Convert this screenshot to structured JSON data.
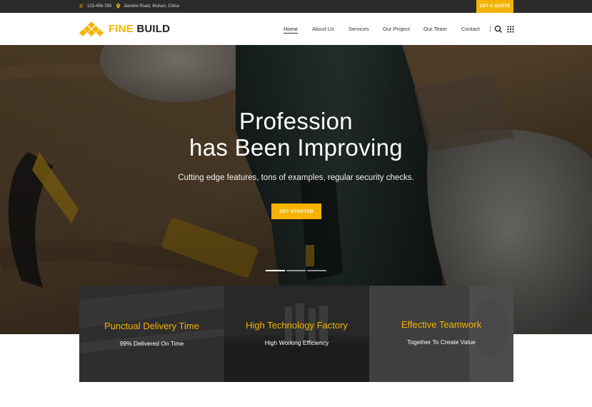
{
  "topbar": {
    "phone": "123-456-789",
    "address": "Jianshe Road, Wuhan, China",
    "quote_label": "GET A QUOTE"
  },
  "logo": {
    "word1": "FINE",
    "word2": "BUILD"
  },
  "nav": {
    "items": [
      {
        "label": "Home",
        "active": true
      },
      {
        "label": "About Us"
      },
      {
        "label": "Services"
      },
      {
        "label": "Our Project"
      },
      {
        "label": "Our Team"
      },
      {
        "label": "Contact"
      }
    ]
  },
  "hero": {
    "title_line1": "Profession",
    "title_line2": "has Been Improving",
    "subtitle": "Cutting edge features, tons of examples, regular security checks.",
    "cta_label": "GET STARTED",
    "slides": 3,
    "active_slide": 1
  },
  "features": [
    {
      "title": "Punctual Delivery Time",
      "subtitle": "99% Delivered On Time"
    },
    {
      "title": "High Technology Factory",
      "subtitle": "High Working Efficiency"
    },
    {
      "title": "Effective Teamwork",
      "subtitle": "Together To Create Value"
    }
  ],
  "colors": {
    "accent": "#f5b300",
    "topbar": "#2b2b2b",
    "dark_text": "#222222"
  },
  "icons": [
    "phone-icon",
    "location-icon",
    "search-icon",
    "grid-menu-icon",
    "logo-diamond-icon"
  ]
}
